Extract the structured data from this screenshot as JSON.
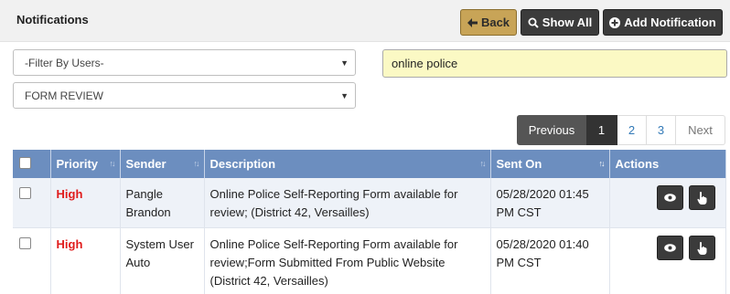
{
  "header": {
    "title": "Notifications",
    "back_label": "Back",
    "show_all_label": "Show All",
    "add_label": "Add Notification"
  },
  "filters": {
    "users_value": "-Filter By Users-",
    "form_value": "FORM REVIEW"
  },
  "search": {
    "value": "online police"
  },
  "pagination": {
    "previous": "Previous",
    "pages": [
      "1",
      "2",
      "3"
    ],
    "current": "1",
    "next": "Next"
  },
  "table": {
    "columns": [
      "Priority",
      "Sender",
      "Description",
      "Sent On",
      "Actions"
    ],
    "rows": [
      {
        "priority": "High",
        "sender": "Pangle Brandon",
        "description": "Online Police Self-Reporting Form available for review; (District 42, Versailles)",
        "sent_on": "05/28/2020 01:45 PM CST"
      },
      {
        "priority": "High",
        "sender": "System User Auto",
        "description": "Online Police Self-Reporting Form available for review;Form Submitted From Public Website (District 42, Versailles)",
        "sent_on": "05/28/2020 01:40 PM CST"
      }
    ]
  },
  "colors": {
    "header_bg": "#6c8ebf",
    "back_button": "#c8a457",
    "dark_button": "#3b3b3b",
    "priority_high": "#e01b1b",
    "search_bg": "#fbf9c4"
  },
  "icons": {
    "back": "arrow-left-icon",
    "show_all": "search-icon",
    "add": "plus-circle-icon",
    "view": "eye-icon",
    "action": "hand-pointer-icon"
  }
}
